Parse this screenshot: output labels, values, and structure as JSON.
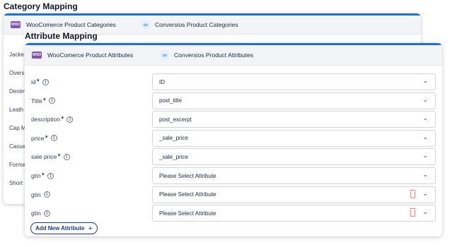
{
  "category_mapping": {
    "title": "Category Mapping",
    "headers": {
      "woo": "WooComerce Product Categories",
      "conversios": "Conversios Product Categories"
    },
    "items": [
      "Jacke",
      "Overs",
      "Denim",
      "Leath",
      "Cap M",
      "Casua",
      "Forma",
      "Short"
    ]
  },
  "attribute_mapping": {
    "title": "Attribute Mapping",
    "headers": {
      "woo": "WooComerce Product Attributes",
      "conversios": "Conversios Product Attributes"
    },
    "rows": [
      {
        "label": "id",
        "required": "*",
        "value": "ID",
        "deletable": false
      },
      {
        "label": "Title",
        "required": "*",
        "value": "post_title",
        "deletable": false
      },
      {
        "label": "description",
        "required": "*",
        "value": "post_excerpt",
        "deletable": false
      },
      {
        "label": "price",
        "required": "*",
        "value": "_sale_price",
        "deletable": false
      },
      {
        "label": "sale price",
        "required": "*",
        "value": "_sale_price",
        "deletable": false
      },
      {
        "label": "gtin",
        "required": "*",
        "value": "Please Select Attribute",
        "deletable": false
      },
      {
        "label": "gtin",
        "required": "",
        "value": "Please Select Attribute",
        "deletable": true
      },
      {
        "label": "gtin",
        "required": "",
        "value": "Please Select Attribute",
        "deletable": true
      }
    ],
    "add_button": "Add New Attribute",
    "add_icon": "plus-icon",
    "chevron_icon": "chevron-down-icon",
    "info_icon": "info-icon",
    "delete_icon": "trash-icon"
  },
  "badges": {
    "woo": "WOO",
    "conversios_icon": "infinity-icon"
  },
  "colors": {
    "accent": "#1e6fdc",
    "woo": "#7f54b3",
    "danger": "#f08a8a",
    "button": "#1e3a8a"
  }
}
